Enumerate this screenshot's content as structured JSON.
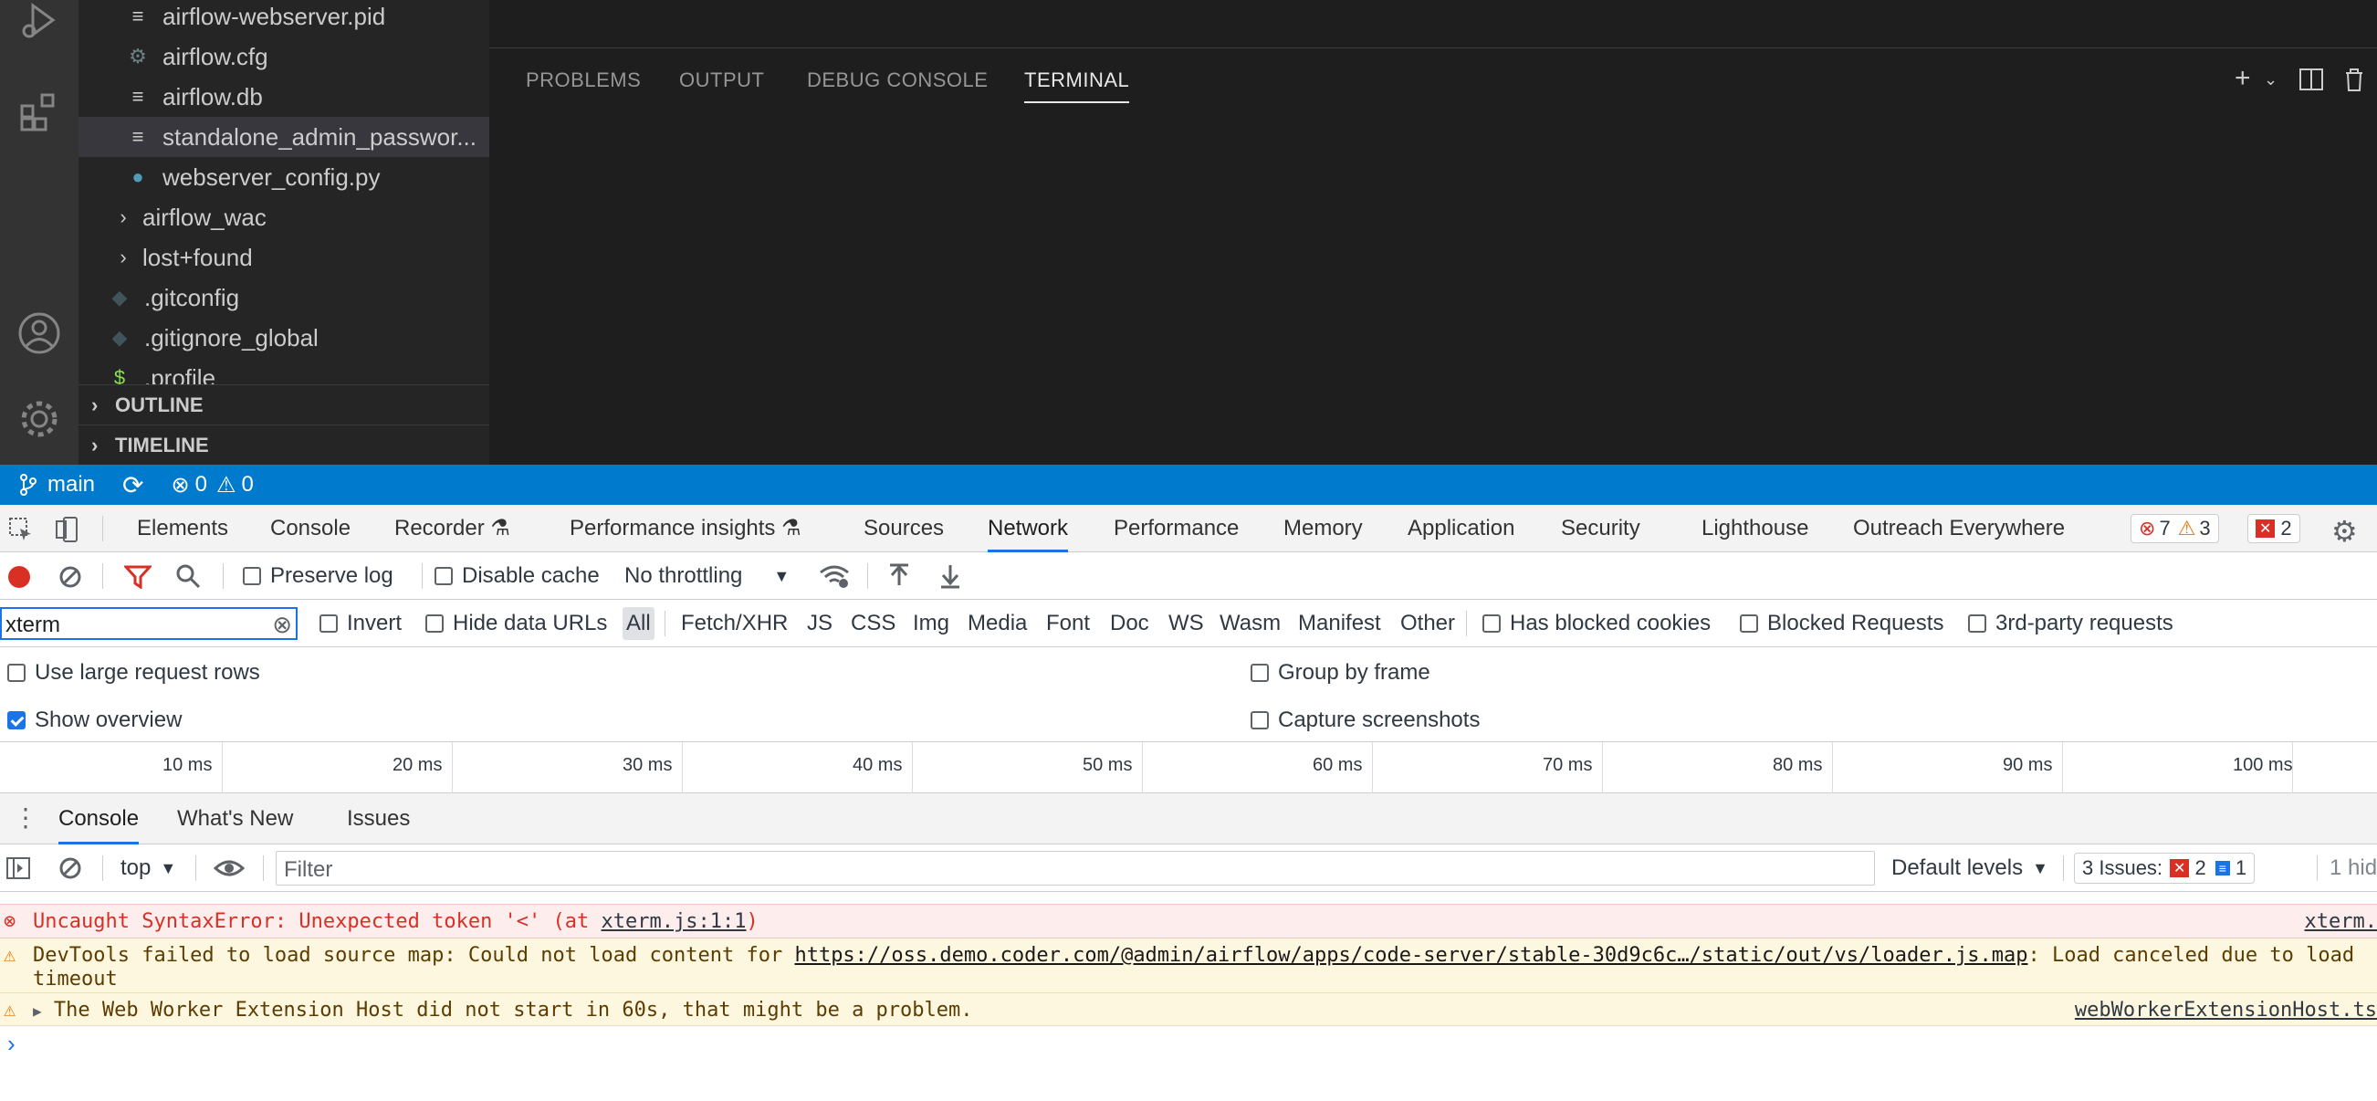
{
  "explorer": {
    "items": [
      {
        "icon": "lines-icon",
        "label": "airflow-webserver.pid"
      },
      {
        "icon": "gear-icon",
        "label": "airflow.cfg"
      },
      {
        "icon": "lines-icon",
        "label": "airflow.db"
      },
      {
        "icon": "lines-icon",
        "label": "standalone_admin_passwor..."
      },
      {
        "icon": "python-icon",
        "label": "webserver_config.py"
      },
      {
        "icon": "chevron-right-icon",
        "label": "airflow_wac"
      },
      {
        "icon": "chevron-right-icon",
        "label": "lost+found"
      },
      {
        "icon": "diamond-icon",
        "label": ".gitconfig"
      },
      {
        "icon": "diamond-icon",
        "label": ".gitignore_global"
      },
      {
        "icon": "dollar-icon",
        "label": ".profile"
      }
    ],
    "outline_label": "OUTLINE",
    "timeline_label": "TIMELINE"
  },
  "panel": {
    "tabs": [
      "PROBLEMS",
      "OUTPUT",
      "DEBUG CONSOLE",
      "TERMINAL"
    ],
    "active_tab": "TERMINAL"
  },
  "statusbar": {
    "branch": "main",
    "errors": "0",
    "warnings": "0"
  },
  "devtools": {
    "tabs": [
      "Elements",
      "Console",
      "Recorder",
      "Performance insights",
      "Sources",
      "Network",
      "Performance",
      "Memory",
      "Application",
      "Security",
      "Lighthouse",
      "Outreach Everywhere"
    ],
    "active_tab": "Network",
    "badges": {
      "errors": "7",
      "warnings": "3",
      "issues": "2"
    },
    "network_toolbar": {
      "preserve_log": "Preserve log",
      "disable_cache": "Disable cache",
      "throttling": "No throttling"
    },
    "filter": {
      "value": "xterm",
      "invert": "Invert",
      "hide_data_urls": "Hide data URLs",
      "types": [
        "All",
        "Fetch/XHR",
        "JS",
        "CSS",
        "Img",
        "Media",
        "Font",
        "Doc",
        "WS",
        "Wasm",
        "Manifest",
        "Other"
      ],
      "active_type": "All",
      "has_blocked_cookies": "Has blocked cookies",
      "blocked_requests": "Blocked Requests",
      "third_party": "3rd-party requests"
    },
    "settings": {
      "large_rows": "Use large request rows",
      "show_overview": "Show overview",
      "group_by_frame": "Group by frame",
      "capture_screenshots": "Capture screenshots"
    },
    "timeline_ticks": [
      "10 ms",
      "20 ms",
      "30 ms",
      "40 ms",
      "50 ms",
      "60 ms",
      "70 ms",
      "80 ms",
      "90 ms",
      "100 ms"
    ],
    "drawer_tabs": [
      "Console",
      "What's New",
      "Issues"
    ],
    "drawer_active": "Console",
    "console_toolbar": {
      "context": "top",
      "filter_placeholder": "Filter",
      "levels": "Default levels",
      "issues_label": "3 Issues:",
      "issues_err": "2",
      "issues_info": "1",
      "hidden": "1 hid"
    },
    "messages": [
      {
        "type": "error",
        "text": "Uncaught SyntaxError: Unexpected token '<' (at ",
        "link": "xterm.js:1:1",
        "tail": ")",
        "source": "xterm."
      },
      {
        "type": "warning",
        "text": "DevTools failed to load source map: Could not load content for ",
        "link": "https://oss.demo.coder.com/@admin/airflow/apps/code-server/stable-30d9c6c…/static/out/vs/loader.js.map",
        "tail": ": Load canceled due to load",
        "line2": "timeout"
      },
      {
        "type": "warning",
        "text": "The Web Worker Extension Host did not start in 60s, that might be a problem.",
        "source": "webWorkerExtensionHost.ts"
      }
    ]
  }
}
